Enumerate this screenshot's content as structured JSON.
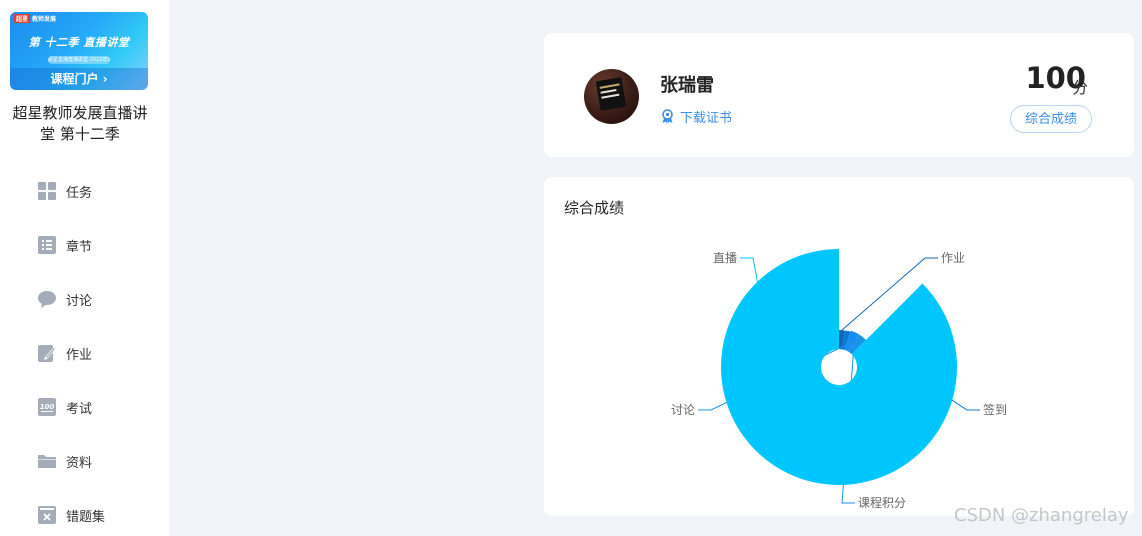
{
  "sidebar": {
    "cover": {
      "brand": "教师发展",
      "brand_mark": "超星",
      "season": "第 十二季 直播讲堂",
      "pill": "超星直播直播讲堂·2022年5月",
      "portal": "课程门户 ›"
    },
    "course_title": "超星教师发展直播讲堂 第十二季",
    "items": [
      {
        "label": "任务",
        "icon": "grid-icon"
      },
      {
        "label": "章节",
        "icon": "list-icon"
      },
      {
        "label": "讨论",
        "icon": "chat-bubble-icon"
      },
      {
        "label": "作业",
        "icon": "pencil-note-icon"
      },
      {
        "label": "考试",
        "icon": "score-100-icon"
      },
      {
        "label": "资料",
        "icon": "folder-icon"
      },
      {
        "label": "错题集",
        "icon": "wrong-box-icon"
      }
    ]
  },
  "profile": {
    "name": "张瑞雷",
    "certificate_link": "下载证书",
    "score": "100",
    "score_unit": "分",
    "overall_button": "综合成绩"
  },
  "chart_card": {
    "title": "综合成绩"
  },
  "chart_data": {
    "type": "pie",
    "variant": "rose",
    "categories": [
      "作业",
      "签到",
      "课程积分",
      "讨论",
      "直播"
    ],
    "values": [
      2,
      2,
      3,
      3,
      70
    ],
    "colors": [
      "#0f67b1",
      "#0a78d8",
      "#1a8df5",
      "#1a94e8",
      "#00c6ff"
    ],
    "title": "综合成绩",
    "legend": "none"
  },
  "watermark": "CSDN @zhangrelay"
}
